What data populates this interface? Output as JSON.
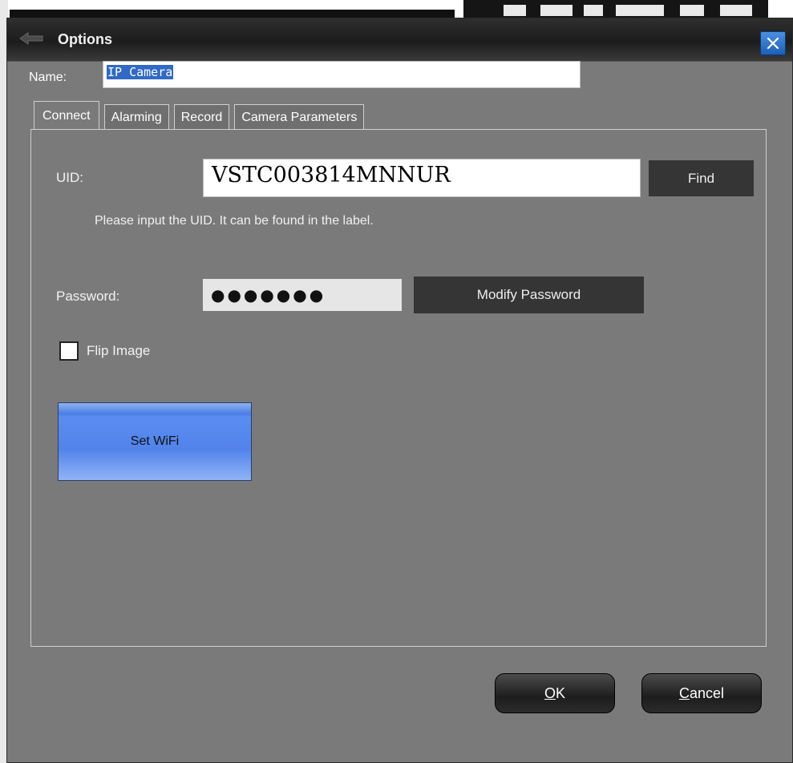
{
  "window": {
    "title": "Options"
  },
  "name": {
    "label": "Name:",
    "value": "IP Camera"
  },
  "tabs": [
    {
      "label": "Connect",
      "active": true
    },
    {
      "label": "Alarming",
      "active": false
    },
    {
      "label": "Record",
      "active": false
    },
    {
      "label": "Camera Parameters",
      "active": false
    }
  ],
  "connect": {
    "uid_label": "UID:",
    "uid_value": "VSTC003814MNNUR",
    "find_label": "Find",
    "uid_hint": "Please input the UID. It can be found in the label.",
    "password_label": "Password:",
    "password_value": "●●●●●●●",
    "modify_password_label": "Modify Password",
    "flip_image_label": "Flip Image",
    "flip_image_checked": false,
    "set_wifi_label": "Set WiFi"
  },
  "footer": {
    "ok_label": "OK",
    "ok_mnemonic": "O",
    "ok_rest": "K",
    "cancel_label": "Cancel",
    "cancel_mnemonic": "C",
    "cancel_rest": "ancel"
  },
  "colors": {
    "dialog_bg": "#7a7a7a",
    "titlebar_bg": "#1c1c1c",
    "close_button": "#1e5fb8",
    "button_dark": "#353535",
    "wifi_button": "#5283ea"
  },
  "icons": {
    "title_icon": "back-arrow-icon",
    "close_icon": "close-icon"
  }
}
